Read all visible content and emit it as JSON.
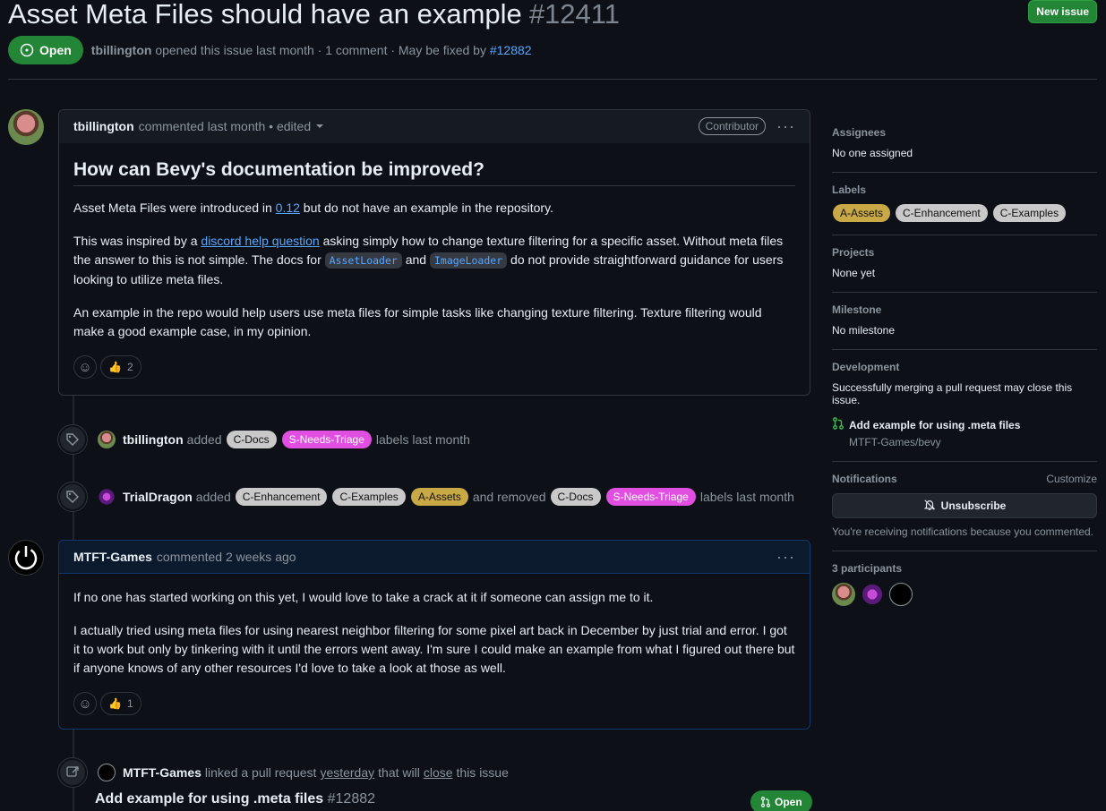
{
  "header": {
    "title": "Asset Meta Files should have an example",
    "number": "#12411",
    "new_issue_label": "New issue",
    "state": "Open",
    "author": "tbillington",
    "meta_text": "opened this issue last month · 1 comment · May be fixed by",
    "fixed_by": "#12882"
  },
  "comment1": {
    "author": "tbillington",
    "meta": "commented last month • edited",
    "role": "Contributor",
    "heading": "How can Bevy's documentation be improved?",
    "p1_pre": "Asset Meta Files were introduced in",
    "p1_link": "0.12",
    "p1_post": "but do not have an example in the repository.",
    "p2_pre": "This was inspired by a",
    "p2_link": "discord help question",
    "p2_mid1": "asking simply how to change texture filtering for a specific asset. Without meta files the answer to this is not simple. The docs for",
    "p2_code1": "AssetLoader",
    "p2_and": "and",
    "p2_code2": "ImageLoader",
    "p2_post": "do not provide straightforward guidance for users looking to utilize meta files.",
    "p3": "An example in the repo would help users use meta files for simple tasks like changing texture filtering. Texture filtering would make a good example case, in my opinion.",
    "thumbs_count": "2"
  },
  "event1": {
    "author": "tbillington",
    "verb": "added",
    "labels": [
      "C-Docs",
      "S-Needs-Triage"
    ],
    "suffix": "labels last month"
  },
  "event2": {
    "author": "TrialDragon",
    "verb": "added",
    "added_labels": [
      "C-Enhancement",
      "C-Examples",
      "A-Assets"
    ],
    "mid": "and removed",
    "removed_labels": [
      "C-Docs",
      "S-Needs-Triage"
    ],
    "suffix": "labels last month"
  },
  "comment2": {
    "author": "MTFT-Games",
    "meta": "commented 2 weeks ago",
    "p1": "If no one has started working on this yet, I would love to take a crack at it if someone can assign me to it.",
    "p2": "I actually tried using meta files for using nearest neighbor filtering for some pixel art back in December by just trial and error. I got it to work but only by tinkering with it until the errors went away. I'm sure I could make an example from what I figured out there but if anyone knows of any other resources I'd love to take a look at those as well.",
    "thumbs_count": "1"
  },
  "event3": {
    "author": "MTFT-Games",
    "text1": "linked a pull request",
    "when": "yesterday",
    "text2": "that will",
    "close": "close",
    "text3": "this issue",
    "pr_title": "Add example for using .meta files",
    "pr_num": "#12882",
    "pr_state": "Open"
  },
  "sidebar": {
    "assignees_head": "Assignees",
    "assignees_val": "No one assigned",
    "labels_head": "Labels",
    "labels": [
      "A-Assets",
      "C-Enhancement",
      "C-Examples"
    ],
    "projects_head": "Projects",
    "projects_val": "None yet",
    "milestone_head": "Milestone",
    "milestone_val": "No milestone",
    "development_head": "Development",
    "development_note": "Successfully merging a pull request may close this issue.",
    "dev_pr": "Add example for using .meta files",
    "dev_repo": "MTFT-Games/bevy",
    "notifications_head": "Notifications",
    "customize": "Customize",
    "unsubscribe": "Unsubscribe",
    "notif_note": "You're receiving notifications because you commented.",
    "participants_head": "3 participants"
  },
  "colors": {
    "background": "#0d1117",
    "open_green": "#238636",
    "link_blue": "#58a6ff",
    "label_pink": "#e14fe1",
    "label_gold": "#c9a846",
    "label_gray": "#c9c9c9"
  }
}
